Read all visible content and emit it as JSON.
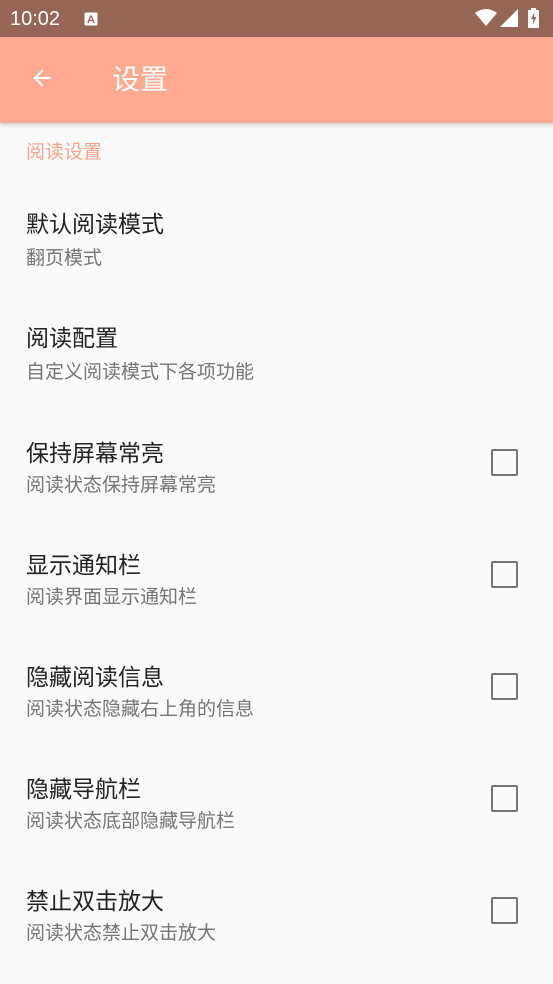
{
  "status_bar": {
    "time": "10:02",
    "notification_icon": "a-icon",
    "wifi_icon": "wifi-icon",
    "signal_icon": "signal-icon",
    "battery_icon": "battery-charging-icon"
  },
  "app_bar": {
    "back_icon": "arrow-left-icon",
    "title": "设置"
  },
  "colors": {
    "status_bar": "#956656",
    "app_bar": "#ffa990",
    "accent": "#f6a38d",
    "background": "#fafafa"
  },
  "settings": {
    "category": "阅读设置",
    "items": [
      {
        "title": "默认阅读模式",
        "summary": "翻页模式",
        "has_checkbox": false
      },
      {
        "title": "阅读配置",
        "summary": "自定义阅读模式下各项功能",
        "has_checkbox": false
      },
      {
        "title": "保持屏幕常亮",
        "summary": "阅读状态保持屏幕常亮",
        "has_checkbox": true,
        "checked": false
      },
      {
        "title": "显示通知栏",
        "summary": "阅读界面显示通知栏",
        "has_checkbox": true,
        "checked": false
      },
      {
        "title": "隐藏阅读信息",
        "summary": "阅读状态隐藏右上角的信息",
        "has_checkbox": true,
        "checked": false
      },
      {
        "title": "隐藏导航栏",
        "summary": "阅读状态底部隐藏导航栏",
        "has_checkbox": true,
        "checked": false
      },
      {
        "title": "禁止双击放大",
        "summary": "阅读状态禁止双击放大",
        "has_checkbox": true,
        "checked": false
      }
    ]
  }
}
